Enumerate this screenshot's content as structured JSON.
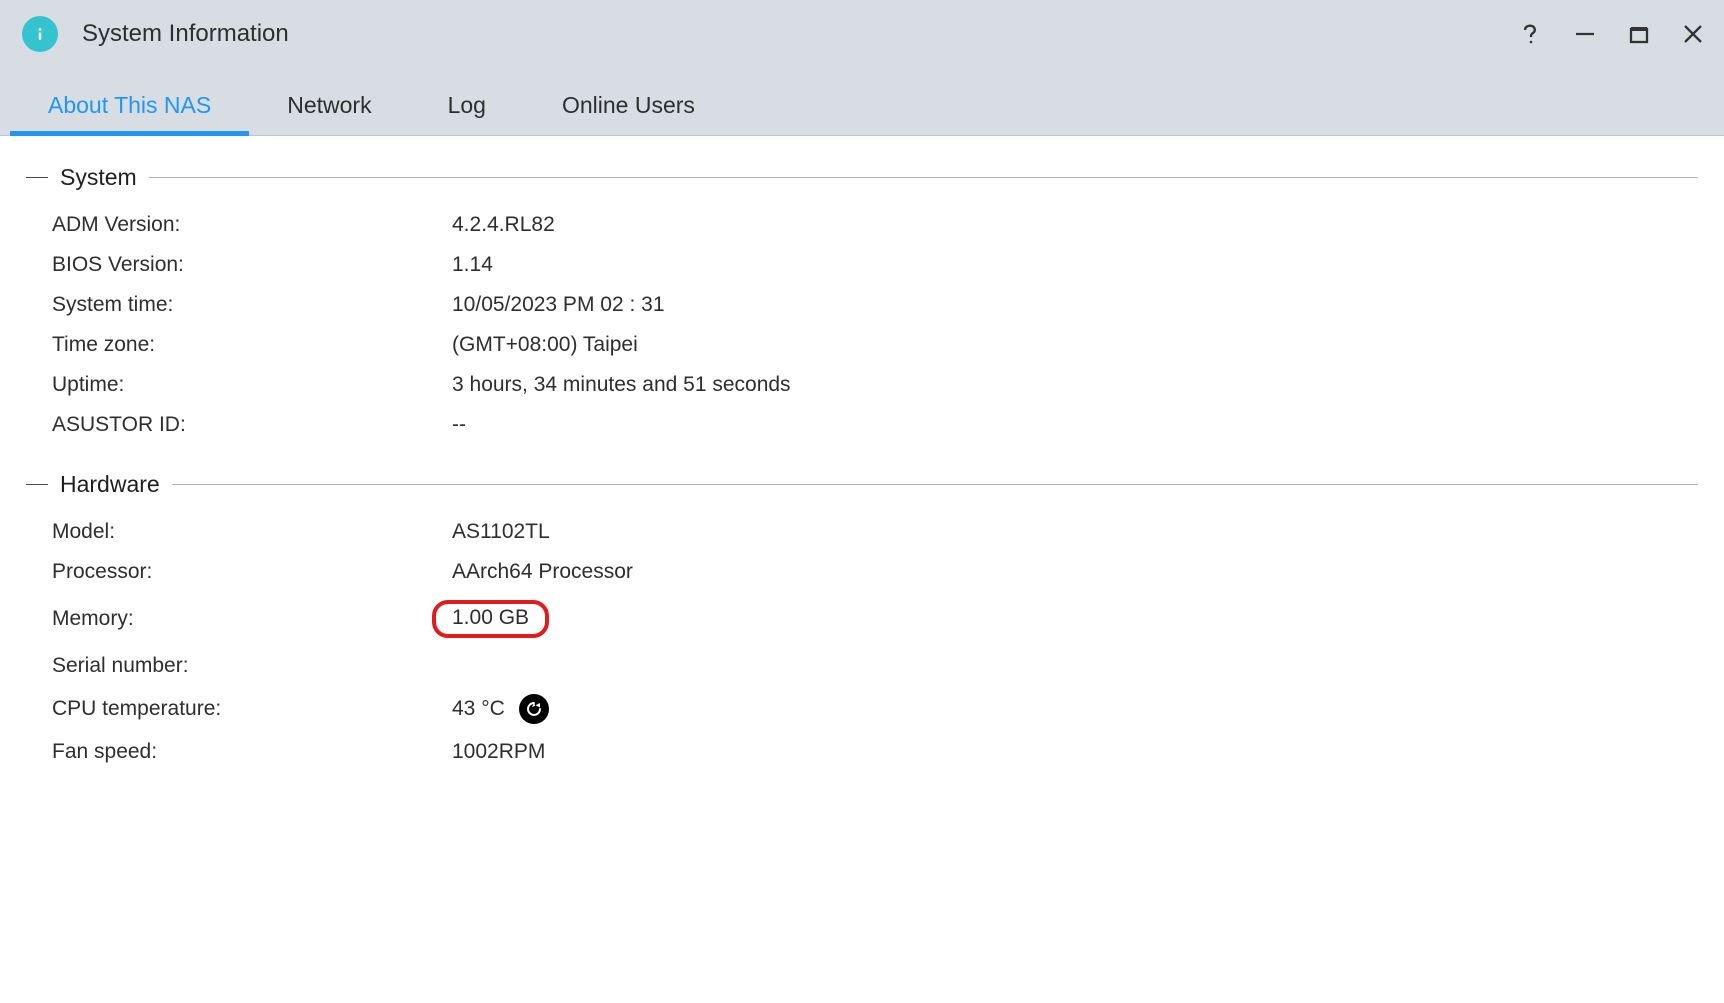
{
  "window": {
    "title": "System Information"
  },
  "tabs": {
    "about": "About This NAS",
    "network": "Network",
    "log": "Log",
    "online_users": "Online Users"
  },
  "sections": {
    "system": {
      "title": "System",
      "adm_version_label": "ADM Version:",
      "adm_version_value": "4.2.4.RL82",
      "bios_version_label": "BIOS Version:",
      "bios_version_value": "1.14",
      "system_time_label": "System time:",
      "system_time_value": "10/05/2023  PM 02 : 31",
      "time_zone_label": "Time zone:",
      "time_zone_value": "(GMT+08:00) Taipei",
      "uptime_label": "Uptime:",
      "uptime_value": "3 hours, 34 minutes and 51 seconds",
      "asustor_id_label": "ASUSTOR ID:",
      "asustor_id_value": "--"
    },
    "hardware": {
      "title": "Hardware",
      "model_label": "Model:",
      "model_value": "AS1102TL",
      "processor_label": "Processor:",
      "processor_value": "AArch64 Processor",
      "memory_label": "Memory:",
      "memory_value": "1.00 GB",
      "serial_label": "Serial number:",
      "serial_value": "",
      "cpu_temp_label": "CPU temperature:",
      "cpu_temp_value": "43 °C",
      "fan_speed_label": "Fan speed:",
      "fan_speed_value": "1002RPM"
    }
  }
}
